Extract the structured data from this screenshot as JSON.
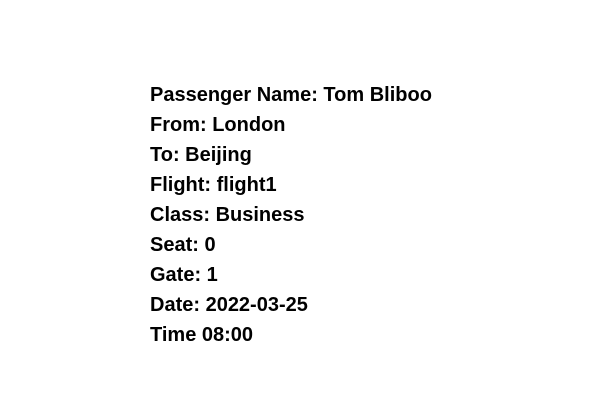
{
  "ticket": {
    "passenger_name": "Passenger Name: Tom Bliboo",
    "from": "From: London",
    "to": "To: Beijing",
    "flight": "Flight: flight1",
    "class": "Class: Business",
    "seat": "Seat: 0",
    "gate": "Gate: 1",
    "date": "Date: 2022-03-25",
    "time": "Time 08:00"
  }
}
